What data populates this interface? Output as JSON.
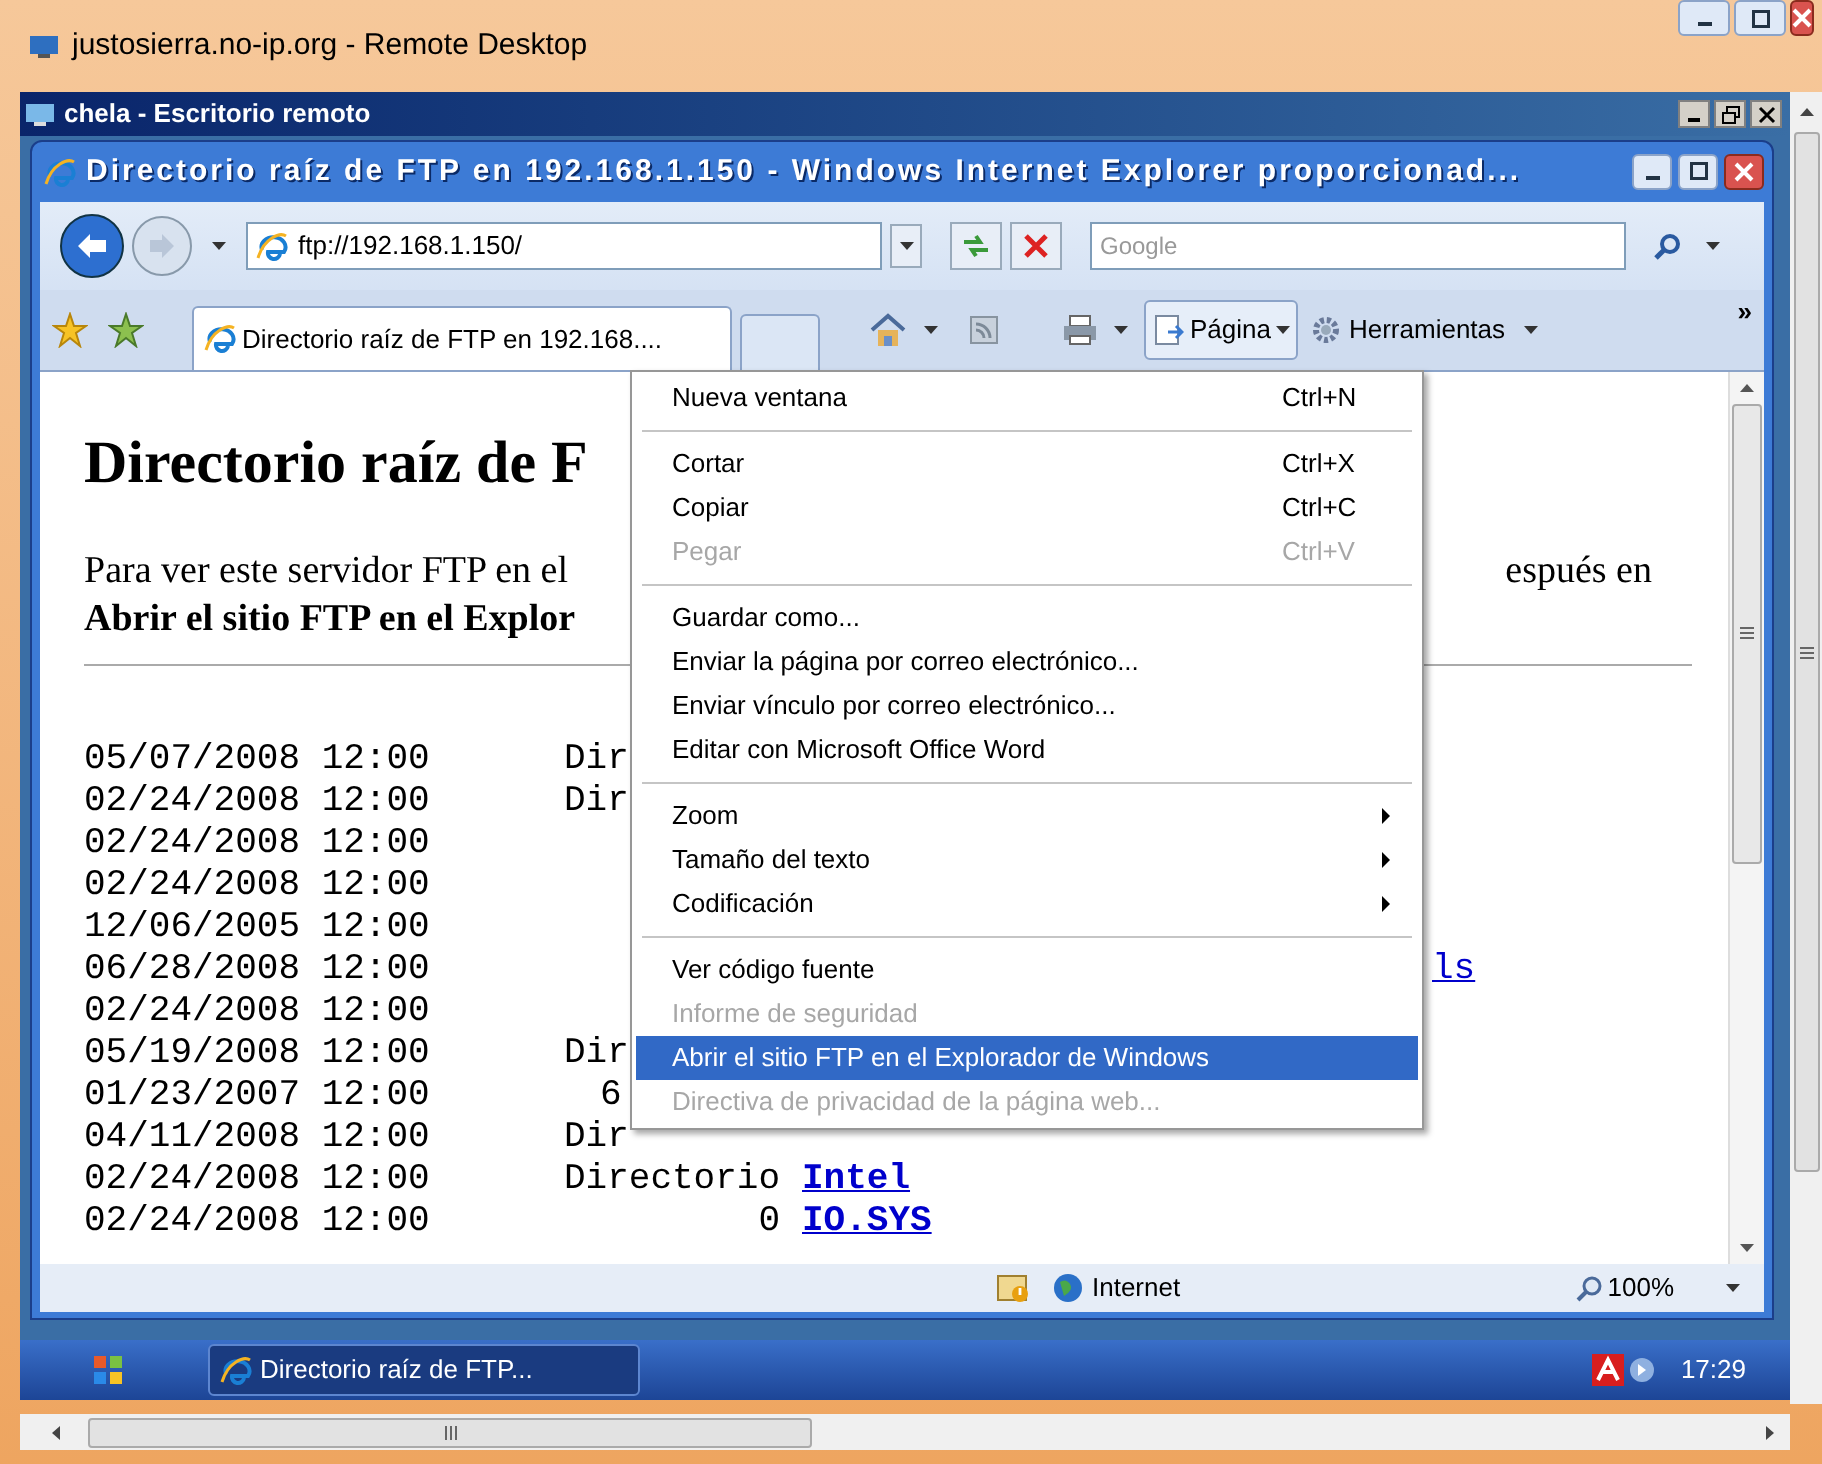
{
  "outer_window": {
    "title": "justosierra.no-ip.org - Remote Desktop"
  },
  "remote_window": {
    "title": "chela - Escritorio remoto"
  },
  "browser": {
    "title": "Directorio raíz de FTP en 192.168.1.150 - Windows Internet Explorer proporcionad...",
    "address": "ftp://192.168.1.150/",
    "search_placeholder": "Google",
    "tab": {
      "label": "Directorio raíz de FTP en 192.168....",
      "selected": true
    },
    "toolbar": {
      "page_button": "Página",
      "tools_button": "Herramientas",
      "overflow": "»"
    },
    "status_bar": {
      "zone": "Internet",
      "zoom": "100%"
    }
  },
  "page": {
    "heading": "Directorio raíz de F",
    "paragraph_left": "Para ver este servidor FTP en el",
    "paragraph_right": "espués en",
    "bold_line": "Abrir el sitio FTP en el Explor",
    "rows": [
      {
        "date": "05/07/2008 12:00",
        "kind": "directory",
        "column_3": "Dir"
      },
      {
        "date": "02/24/2008 12:00",
        "kind": "directory",
        "column_3": "Dir"
      },
      {
        "date": "02/24/2008 12:00"
      },
      {
        "date": "02/24/2008 12:00"
      },
      {
        "date": "12/06/2005 12:00"
      },
      {
        "date": "06/28/2008 12:00",
        "name_end": "ls"
      },
      {
        "date": "02/24/2008 12:00"
      },
      {
        "date": "05/19/2008 12:00",
        "kind": "directory",
        "column_3": "Dir"
      },
      {
        "date": "01/23/2007 12:00",
        "kind": "cut",
        "column_3": "6"
      },
      {
        "date": "04/11/2008 12:00",
        "kind": "directory",
        "column_3": "Dir"
      },
      {
        "date": "02/24/2008 12:00",
        "kind": "directory",
        "column_3": "Directorio",
        "name": "Intel"
      },
      {
        "date": "02/24/2008 12:00",
        "kind": "file",
        "column_3": "0",
        "name": "IO.SYS"
      }
    ]
  },
  "menu": {
    "groups": [
      [
        {
          "label": "Nueva ventana",
          "shortcut": "Ctrl+N",
          "disabled": false,
          "selected": false
        }
      ],
      [
        {
          "label": "Cortar",
          "shortcut": "Ctrl+X",
          "disabled": false,
          "selected": false
        },
        {
          "label": "Copiar",
          "shortcut": "Ctrl+C",
          "disabled": false,
          "selected": false
        },
        {
          "label": "Pegar",
          "shortcut": "Ctrl+V",
          "disabled": true,
          "selected": false
        }
      ],
      [
        {
          "label": "Guardar como...",
          "disabled": false,
          "selected": false
        },
        {
          "label": "Enviar la página por correo electrónico...",
          "disabled": false,
          "selected": false
        },
        {
          "label": "Enviar vínculo por correo electrónico...",
          "disabled": false,
          "selected": false
        },
        {
          "label": "Editar con Microsoft Office Word",
          "disabled": false,
          "selected": false
        }
      ],
      [
        {
          "label": "Zoom",
          "submenu": true,
          "disabled": false,
          "selected": false
        },
        {
          "label": "Tamaño del texto",
          "submenu": true,
          "disabled": false,
          "selected": false
        },
        {
          "label": "Codificación",
          "submenu": true,
          "disabled": false,
          "selected": false
        }
      ],
      [
        {
          "label": "Ver código fuente",
          "disabled": false,
          "selected": false
        },
        {
          "label": "Informe de seguridad",
          "disabled": true,
          "selected": false
        },
        {
          "label": "Abrir el sitio FTP en el Explorador de Windows",
          "disabled": false,
          "selected": true
        },
        {
          "label": "Directiva de privacidad de la página web...",
          "disabled": true,
          "selected": false
        }
      ]
    ]
  },
  "taskbar": {
    "task_button": "Directorio raíz de FTP...",
    "clock": "17:29"
  }
}
